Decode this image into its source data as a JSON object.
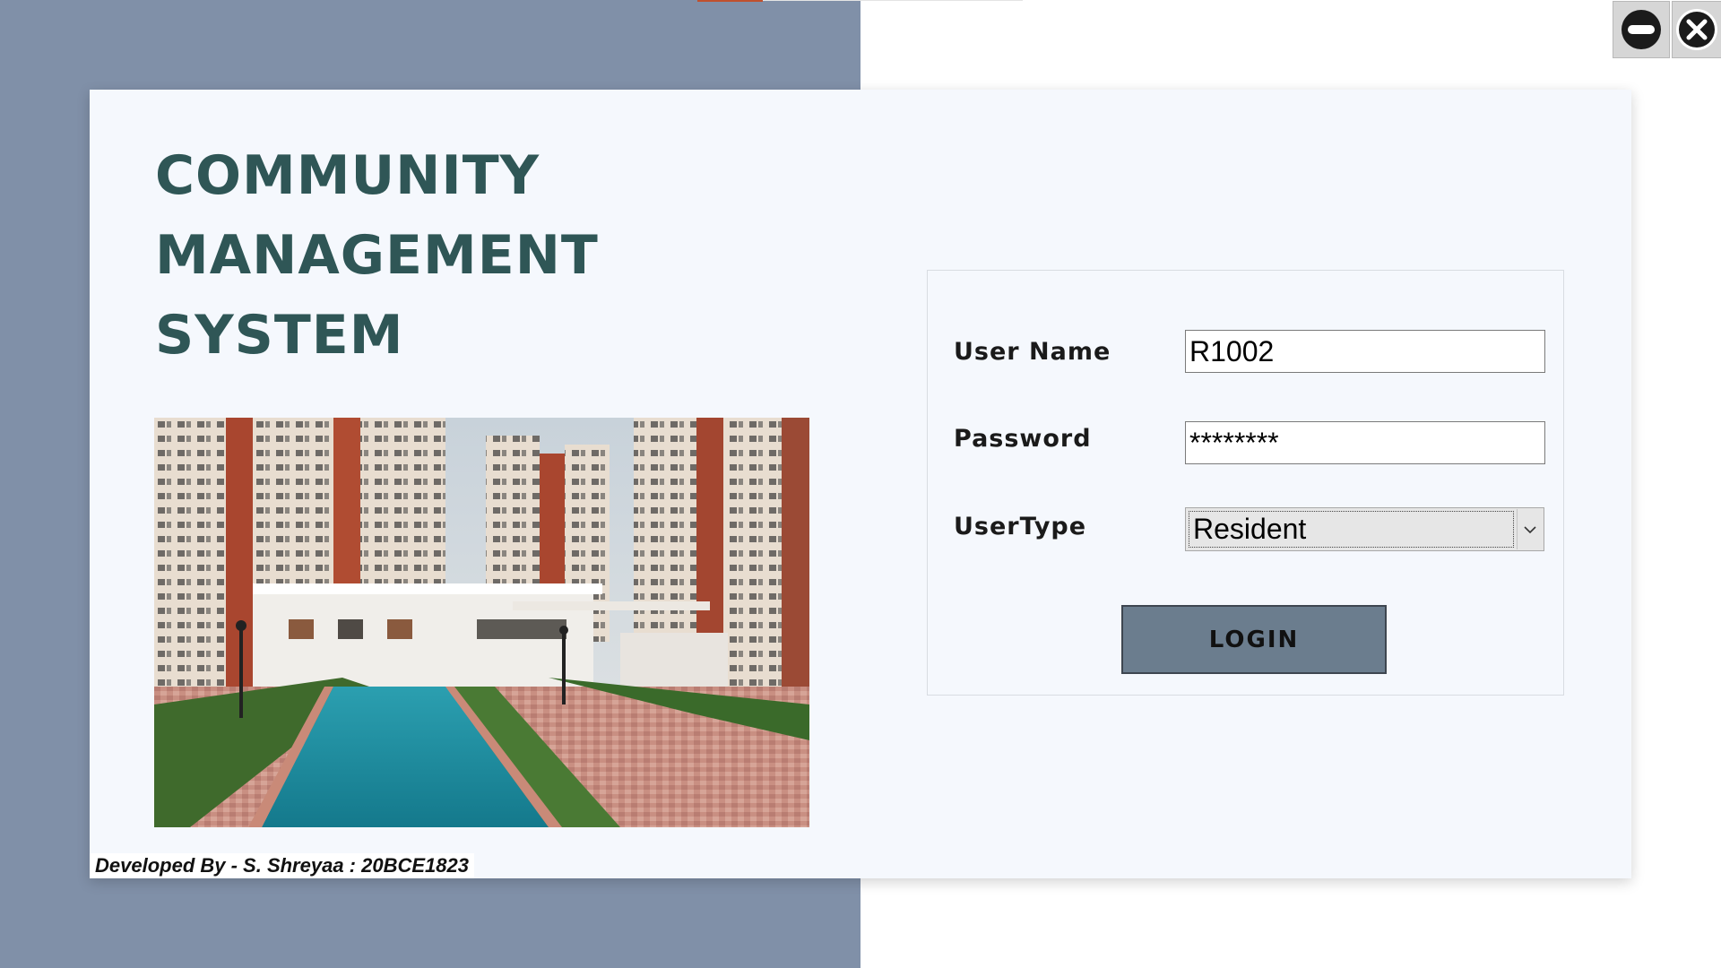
{
  "app": {
    "title_lines": [
      "COMMUNITY",
      "MANAGEMENT",
      "SYSTEM"
    ],
    "credit": "Developed By - S. Shreyaa : 20BCE1823"
  },
  "window_controls": {
    "minimize_icon": "minus-circle-icon",
    "close_icon": "x-circle-icon"
  },
  "login": {
    "username_label": "User Name",
    "username_value": "R1002",
    "password_label": "Password",
    "password_value": "********",
    "usertype_label": "UserType",
    "usertype_selected": "Resident",
    "login_label": "LOGIN"
  },
  "colors": {
    "left_background": "#8090a8",
    "title": "#2f5656",
    "login_button": "#6b7d8e",
    "card": "#f5f8fd"
  }
}
